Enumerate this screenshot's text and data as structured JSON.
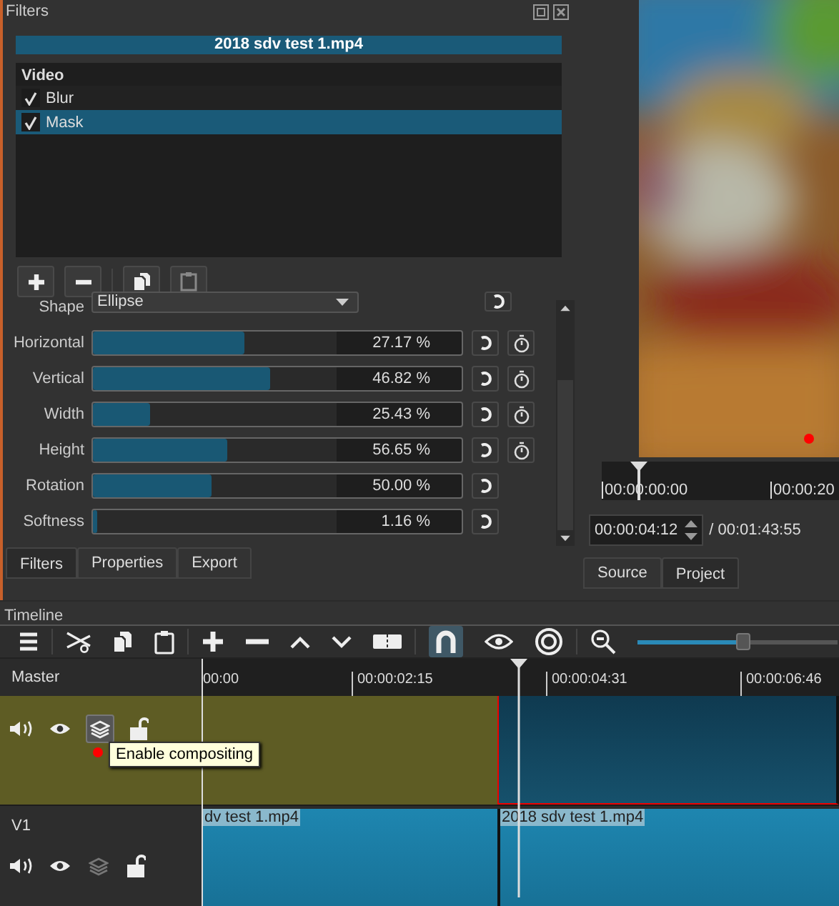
{
  "filters_panel": {
    "title": "Filters",
    "clip_title": "2018 sdv test 1.mp4",
    "list_group": "Video",
    "filters": [
      {
        "name": "Blur",
        "checked": true,
        "selected": false
      },
      {
        "name": "Mask",
        "checked": true,
        "selected": true
      }
    ],
    "shape": {
      "label": "Shape",
      "value": "Ellipse"
    },
    "params": [
      {
        "label": "Horizontal",
        "level": 0.41,
        "reading": "27.17 %",
        "keyframes": true
      },
      {
        "label": "Vertical",
        "level": 0.48,
        "reading": "46.82 %",
        "keyframes": true
      },
      {
        "label": "Width",
        "level": 0.155,
        "reading": "25.43 %",
        "keyframes": true
      },
      {
        "label": "Height",
        "level": 0.365,
        "reading": "56.65 %",
        "keyframes": true
      },
      {
        "label": "Rotation",
        "level": 0.32,
        "reading": "50.00 %",
        "keyframes": false
      },
      {
        "label": "Softness",
        "level": 0.012,
        "reading": "1.16 %",
        "keyframes": false
      }
    ],
    "tabs": [
      {
        "label": "Filters",
        "selected": true
      },
      {
        "label": "Properties",
        "selected": false
      },
      {
        "label": "Export",
        "selected": false
      }
    ]
  },
  "viewer": {
    "ruler_labels": [
      "00:00:00:00",
      "00:00:20"
    ],
    "timecode": "00:00:04:12",
    "duration": "/ 00:01:43:55",
    "tabs": [
      {
        "label": "Source",
        "selected": false
      },
      {
        "label": "Project",
        "selected": true
      }
    ]
  },
  "timeline": {
    "title": "Timeline",
    "zoom": {
      "level": 0.53
    },
    "header": "Master",
    "ruler_labels": [
      "00:00",
      "00:00:02:15",
      "00:00:04:31",
      "00:00:06:46"
    ],
    "tracks": [
      {
        "selected": true,
        "compositing": true,
        "clips": [
          {
            "selected": true
          }
        ]
      },
      {
        "name": "V1",
        "selected": false,
        "compositing": false,
        "clips": [
          {
            "label": "dv test 1.mp4",
            "selected": false
          },
          {
            "label": "2018 sdv test 1.mp4",
            "selected": false
          }
        ]
      }
    ],
    "tooltip": "Enable compositing"
  }
}
